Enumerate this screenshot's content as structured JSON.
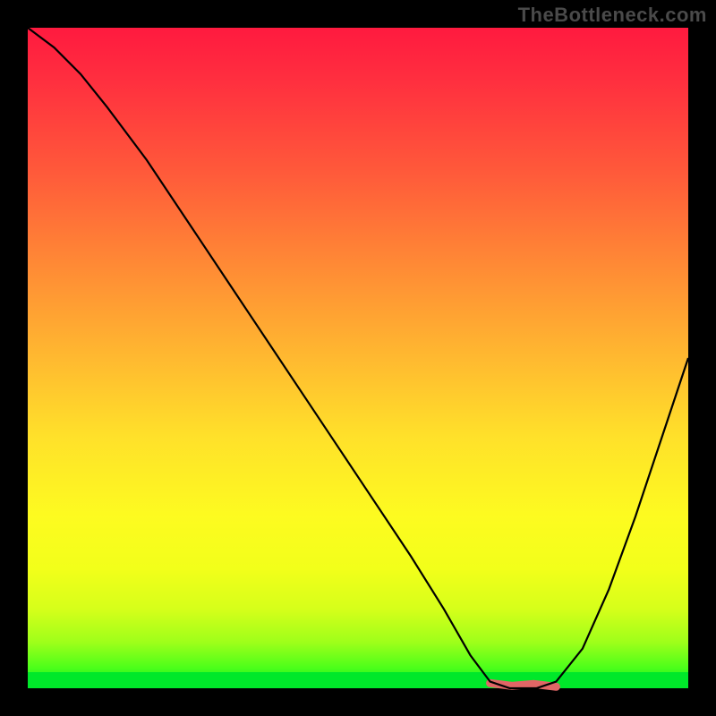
{
  "watermark": "TheBottleneck.com",
  "chart_data": {
    "type": "line",
    "title": "",
    "xlabel": "",
    "ylabel": "",
    "xlim": [
      0,
      100
    ],
    "ylim": [
      0,
      100
    ],
    "grid": false,
    "series": [
      {
        "name": "bottleneck-curve",
        "x": [
          0,
          4,
          8,
          12,
          18,
          26,
          34,
          42,
          50,
          58,
          63,
          67,
          70,
          73,
          77,
          80,
          84,
          88,
          92,
          96,
          100
        ],
        "y": [
          100,
          97,
          93,
          88,
          80,
          68,
          56,
          44,
          32,
          20,
          12,
          5,
          1,
          0,
          0,
          1,
          6,
          15,
          26,
          38,
          50
        ]
      }
    ],
    "trough_segment": {
      "x_start": 70,
      "x_end": 80,
      "y": 0.5
    },
    "gradient_stops": [
      {
        "pos": 0,
        "color": "#ff1a3f"
      },
      {
        "pos": 50,
        "color": "#ffe12a"
      },
      {
        "pos": 100,
        "color": "#00e82a"
      }
    ]
  }
}
